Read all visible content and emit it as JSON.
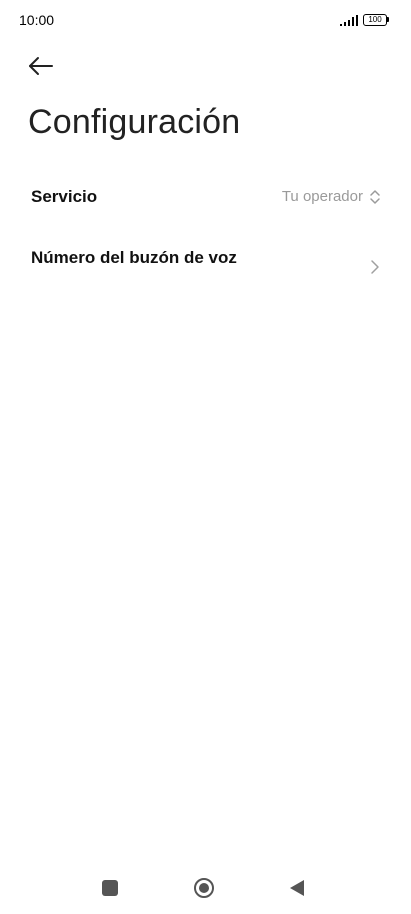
{
  "status_bar": {
    "time": "10:00",
    "battery": "100"
  },
  "header": {
    "back_icon": "arrow-left-icon",
    "title": "Configuración"
  },
  "settings": {
    "service": {
      "label": "Servicio",
      "value": "Tu operador",
      "icon": "up-down-chevron-icon"
    },
    "voicemail_number": {
      "label": "Número del buzón de voz",
      "icon": "chevron-right-icon"
    }
  },
  "nav_bar": {
    "recents_icon": "square-icon",
    "home_icon": "circle-icon",
    "back_icon": "triangle-back-icon"
  }
}
